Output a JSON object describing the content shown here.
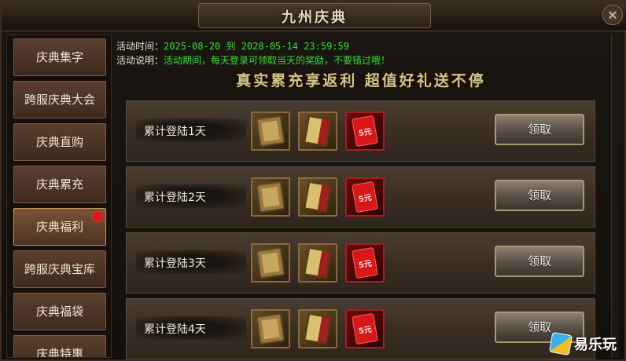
{
  "window": {
    "title": "九州庆典",
    "close_glyph": "✕"
  },
  "sidebar": {
    "items": [
      {
        "label": "庆典集字",
        "active": false
      },
      {
        "label": "跨服庆典大会",
        "active": false
      },
      {
        "label": "庆典直购",
        "active": false
      },
      {
        "label": "庆典累充",
        "active": false
      },
      {
        "label": "庆典福利",
        "active": true,
        "badge": true
      },
      {
        "label": "跨服庆典宝库",
        "active": false
      },
      {
        "label": "庆典福袋",
        "active": false
      },
      {
        "label": "庆典特惠",
        "active": false
      }
    ]
  },
  "info": {
    "time_label": "活动时间：",
    "time_value": "2025-08-20 到 2028-05-14 23:59:59",
    "desc_label": "活动说明：",
    "desc_value": "活动期间，每天登录可领取当天的奖励，不要错过哦！"
  },
  "banner": "真实累充享返利 超值好礼送不停",
  "rows": [
    {
      "label": "累计登陆1天",
      "button": "领取",
      "rewards": [
        "scroll-icon",
        "book-icon",
        "red-packet-icon"
      ]
    },
    {
      "label": "累计登陆2天",
      "button": "领取",
      "rewards": [
        "scroll-icon",
        "book-icon",
        "red-packet-icon"
      ]
    },
    {
      "label": "累计登陆3天",
      "button": "领取",
      "rewards": [
        "scroll-icon",
        "book-icon",
        "red-packet-icon"
      ]
    },
    {
      "label": "累计登陆4天",
      "button": "领取",
      "rewards": [
        "scroll-icon",
        "book-icon",
        "red-packet-icon"
      ]
    }
  ],
  "packet_text": "5元",
  "watermark": "易乐玩",
  "colors": {
    "info_value": "#33e033",
    "badge": "#e81010",
    "banner": "#d6c38a"
  }
}
